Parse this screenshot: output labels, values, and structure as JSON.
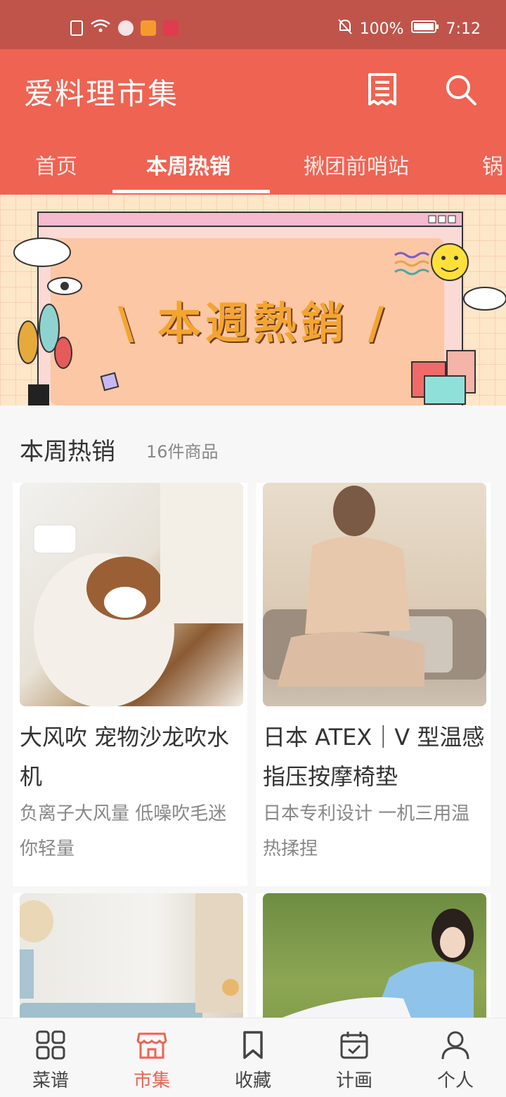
{
  "status_bar": {
    "battery": "100%",
    "time": "7:12",
    "icons": [
      "sim-alert-icon",
      "wifi-icon",
      "vpn-icon",
      "video-app-icon",
      "book-app-icon",
      "mute-icon",
      "battery-icon"
    ]
  },
  "app_bar": {
    "title": "爱料理市集",
    "icons": [
      "receipt-icon",
      "search-icon"
    ]
  },
  "tabs": [
    {
      "label": "首页",
      "active": false
    },
    {
      "label": "本周热销",
      "active": true
    },
    {
      "label": "揪团前哨站",
      "active": false
    },
    {
      "label": "锅",
      "active": false
    }
  ],
  "banner": {
    "headline": "\\ 本週熱銷 /"
  },
  "section": {
    "title": "本周热销",
    "count": "16件商品"
  },
  "products": [
    {
      "name": "大风吹 宠物沙龙吹水机",
      "desc": "负离子大风量 低噪吹毛迷你轻量"
    },
    {
      "name": "日本 ATEX｜V 型温感指压按摩椅垫",
      "desc": "日本专利设计 一机三用温热揉捏"
    },
    {
      "name": "",
      "desc": ""
    },
    {
      "name": "",
      "desc": ""
    }
  ],
  "bottom_nav": [
    {
      "label": "菜谱",
      "icon": "grid-icon",
      "active": false
    },
    {
      "label": "市集",
      "icon": "store-icon",
      "active": true
    },
    {
      "label": "收藏",
      "icon": "bookmark-icon",
      "active": false
    },
    {
      "label": "计画",
      "icon": "calendar-check-icon",
      "active": false
    },
    {
      "label": "个人",
      "icon": "person-icon",
      "active": false
    }
  ],
  "colors": {
    "brand": "#ee6352",
    "status_bar": "#c0544a"
  }
}
